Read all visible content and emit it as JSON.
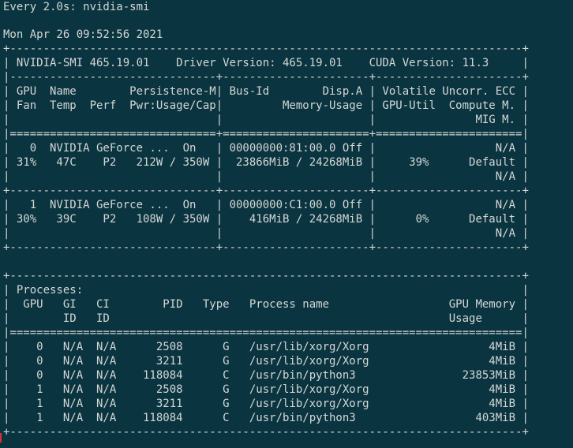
{
  "window": {
    "header": "Every 2.0s: nvidia-smi"
  },
  "output_lines": [
    "Mon Apr 26 09:52:56 2021",
    "+-----------------------------------------------------------------------------+",
    "| NVIDIA-SMI 465.19.01    Driver Version: 465.19.01    CUDA Version: 11.3     |",
    "|-------------------------------+----------------------+----------------------+",
    "| GPU  Name        Persistence-M| Bus-Id        Disp.A | Volatile Uncorr. ECC |",
    "| Fan  Temp  Perf  Pwr:Usage/Cap|         Memory-Usage | GPU-Util  Compute M. |",
    "|                               |                      |               MIG M. |",
    "|===============================+======================+======================|",
    "|   0  NVIDIA GeForce ...  On   | 00000000:81:00.0 Off |                  N/A |",
    "| 31%   47C    P2   212W / 350W |  23866MiB / 24268MiB |     39%      Default |",
    "|                               |                      |                  N/A |",
    "+-------------------------------+----------------------+----------------------+",
    "|   1  NVIDIA GeForce ...  On   | 00000000:C1:00.0 Off |                  N/A |",
    "| 30%   39C    P2   108W / 350W |    416MiB / 24268MiB |      0%      Default |",
    "|                               |                      |                  N/A |",
    "+-------------------------------+----------------------+----------------------+",
    "",
    "+-----------------------------------------------------------------------------+",
    "| Processes:                                                                  |",
    "|  GPU   GI   CI        PID   Type   Process name                  GPU Memory |",
    "|        ID   ID                                                   Usage      |",
    "|=============================================================================|",
    "|    0   N/A  N/A      2508      G   /usr/lib/xorg/Xorg                  4MiB |",
    "|    0   N/A  N/A      3211      G   /usr/lib/xorg/Xorg                  4MiB |",
    "|    0   N/A  N/A    118084      C   /usr/bin/python3                23853MiB |",
    "|    1   N/A  N/A      2508      G   /usr/lib/xorg/Xorg                  4MiB |",
    "|    1   N/A  N/A      3211      G   /usr/lib/xorg/Xorg                  4MiB |",
    "|    1   N/A  N/A    118084      C   /usr/bin/python3                  403MiB |",
    "+-----------------------------------------------------------------------------+"
  ],
  "colors": {
    "background": "#0b3441",
    "foreground": "#d3d8d4",
    "cursor": "#dc322f"
  }
}
